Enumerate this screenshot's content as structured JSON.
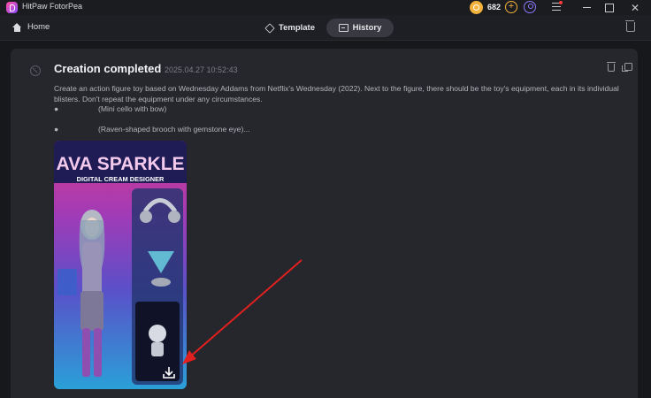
{
  "app": {
    "title": "HitPaw FotorPea",
    "credits": "682"
  },
  "nav": {
    "home_label": "Home",
    "tabs": [
      {
        "label": "Template"
      },
      {
        "label": "History",
        "active": true
      }
    ]
  },
  "creation": {
    "title": "Creation completed",
    "timestamp": "2025.04.27 10:52:43",
    "prompt": "Create an action figure toy based on Wednesday Addams from Netflix's Wednesday (2022). Next to the figure, there should be the toy's equipment, each in its individual blisters. Don't repeat the equipment under any circumstances.",
    "bullets": [
      {
        "dot": "●",
        "text": "(Mini cello with bow)"
      },
      {
        "dot": "●",
        "text": "(Raven-shaped brooch with gemstone eye)..."
      }
    ],
    "image": {
      "headline": "AVA SPARKLE",
      "subline": "DIGITAL CREAM DESIGNER"
    }
  },
  "colors": {
    "accent_coin": "#f3b23c",
    "arrow": "#e0201e",
    "tab_active_bg": "#393a41"
  }
}
